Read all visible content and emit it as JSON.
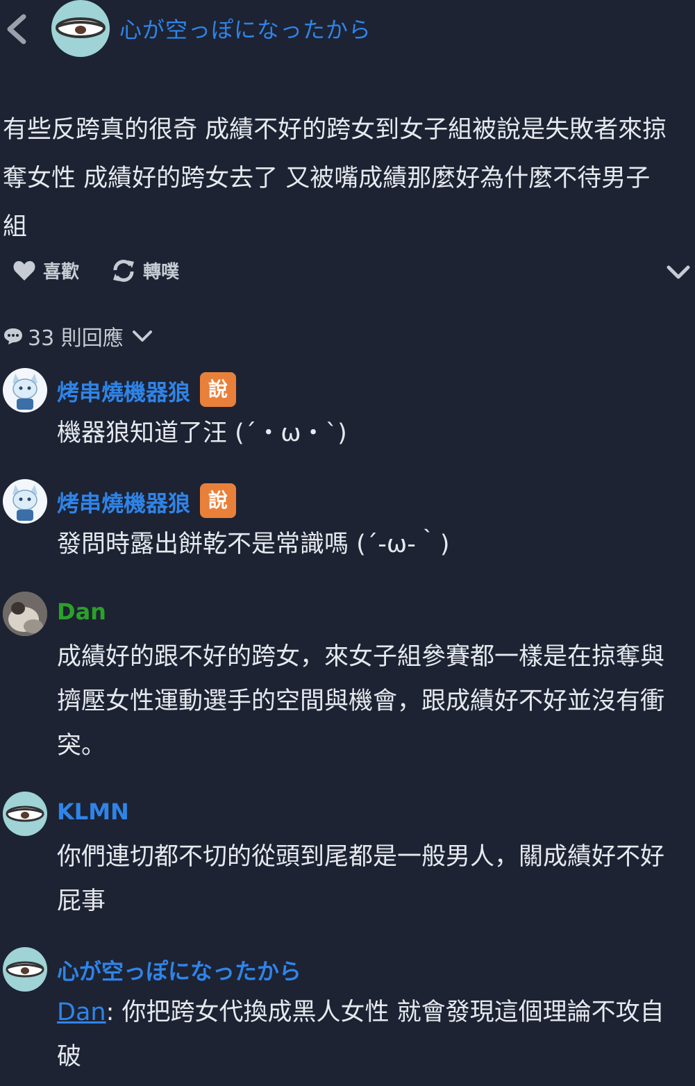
{
  "header": {
    "back_icon": "chevron-left-icon",
    "author": "心が空っぽになったから"
  },
  "post": {
    "lines": [
      "有些反跨真的很奇 成績不好的跨女到女子組被說是失敗者來掠",
      "奪女性 成績好的跨女去了 又被嘴成績那麼好為什麼不待男子",
      "組"
    ]
  },
  "actions": {
    "like_label": "喜歡",
    "replurk_label": "轉噗",
    "more_icon": "chevron-down-icon"
  },
  "responses": {
    "count_label": "33 則回應"
  },
  "replies": [
    {
      "name": "烤串燒機器狼",
      "badge": "說",
      "lines": [
        "機器狼知道了汪 (´・ω・`)"
      ]
    },
    {
      "name": "烤串燒機器狼",
      "badge": "說",
      "lines": [
        "發問時露出餅乾不是常識嗎 (´-ω-｀)"
      ]
    },
    {
      "name": "Dan",
      "lines": [
        "成績好的跟不好的跨女，來女子組參賽都一樣是在掠奪與",
        "擠壓女性運動選手的空間與機會，跟成績好不好並沒有衝",
        "突。"
      ]
    },
    {
      "name": "KLMN",
      "lines": [
        "你們連切都不切的從頭到尾都是一般男人，關成績好不好",
        "屁事"
      ]
    },
    {
      "name": "心が空っぽになったから",
      "mention": "Dan",
      "mention_rest": ": 你把跨女代換成黑人女性 就會發現這個理論不攻自",
      "lines": [
        "破"
      ]
    }
  ],
  "colors": {
    "background": "#1d2333",
    "accent_blue": "#2f84e8",
    "name_green": "#2aa12a",
    "badge_orange": "#e9803a"
  }
}
